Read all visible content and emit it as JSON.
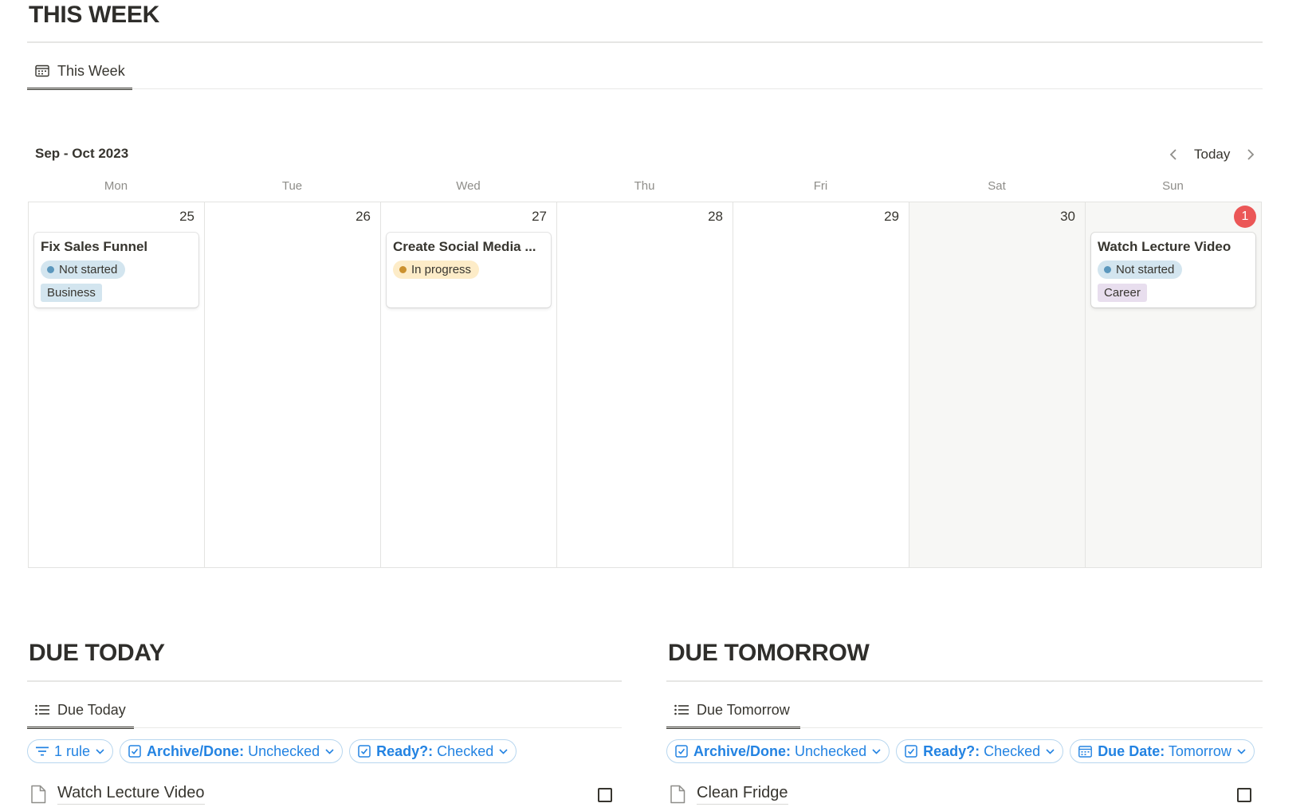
{
  "this_week": {
    "title": "THIS WEEK",
    "tab_label": "This Week",
    "calendar": {
      "month_label": "Sep - Oct 2023",
      "today_label": "Today",
      "weekdays": [
        "Mon",
        "Tue",
        "Wed",
        "Thu",
        "Fri",
        "Sat",
        "Sun"
      ],
      "days": [
        "25",
        "26",
        "27",
        "28",
        "29",
        "30",
        "1"
      ],
      "events": [
        {
          "title": "Fix Sales Funnel",
          "status": "Not started",
          "tag": "Business"
        },
        {
          "title": "Create Social Media ...",
          "status": "In progress",
          "tag": ""
        },
        {
          "title": "Watch Lecture Video",
          "status": "Not started",
          "tag": "Career"
        }
      ]
    }
  },
  "due_today": {
    "title": "DUE TODAY",
    "tab_label": "Due Today",
    "filters": [
      {
        "label": "1 rule"
      },
      {
        "name": "Archive/Done:",
        "value": "Unchecked"
      },
      {
        "name": "Ready?:",
        "value": "Checked"
      }
    ],
    "items": [
      {
        "title": "Watch Lecture Video"
      }
    ]
  },
  "due_tomorrow": {
    "title": "DUE TOMORROW",
    "tab_label": "Due Tomorrow",
    "filters": [
      {
        "name": "Archive/Done:",
        "value": "Unchecked"
      },
      {
        "name": "Ready?:",
        "value": "Checked"
      },
      {
        "name": "Due Date:",
        "value": "Tomorrow"
      }
    ],
    "items": [
      {
        "title": "Clean Fridge"
      }
    ]
  },
  "colors": {
    "not_started_bg": "#d3e5ef",
    "not_started_dot": "#5b97bd",
    "in_progress_bg": "#fdecc8",
    "in_progress_dot": "#cb912f",
    "business_tag_bg": "#d3e5ef",
    "career_tag_bg": "#e8deee",
    "today_badge": "#eb5757",
    "filter_accent": "#2383e2"
  }
}
